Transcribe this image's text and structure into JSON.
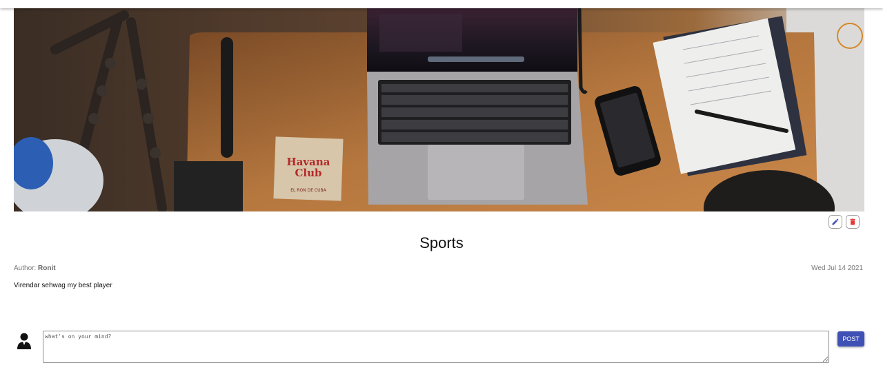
{
  "post": {
    "title": "Sports",
    "author_label": "Author:",
    "author_name": "Ronit",
    "date": "Wed Jul 14 2021",
    "body": "Virendar sehwag my best player",
    "banner_image": {
      "subject": "desk-with-laptop-phone-notebook",
      "coaster_text_line1": "Havana",
      "coaster_text_line2": "Club",
      "coaster_subtext": "EL RON DE CUBA"
    }
  },
  "actions": {
    "edit_icon": "pencil-icon",
    "delete_icon": "trash-icon",
    "edit_color": "#3f51b5",
    "delete_color": "#e53935"
  },
  "comment": {
    "avatar_icon": "user-silhouette-icon",
    "placeholder": "what's on your mind?",
    "value": "",
    "post_label": "POST",
    "post_color": "#3f51b5"
  }
}
